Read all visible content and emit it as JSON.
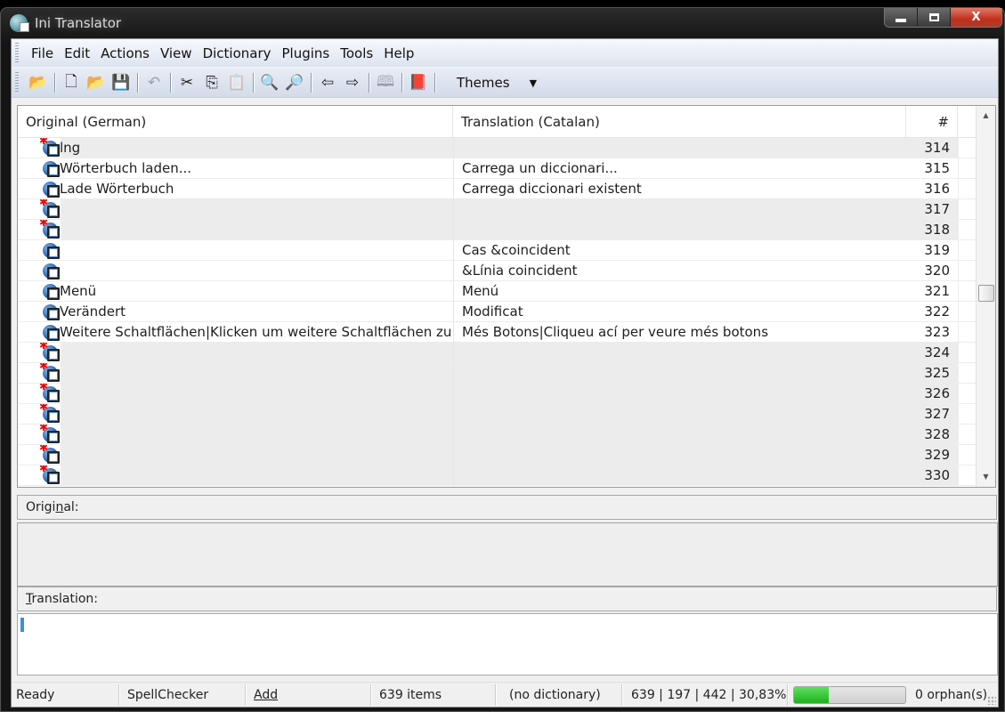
{
  "window": {
    "title": "Ini Translator",
    "controls": {
      "minimize_icon": "minimize-icon",
      "maximize_icon": "maximize-icon",
      "close_label": "X"
    }
  },
  "menubar": {
    "items": [
      "File",
      "Edit",
      "Actions",
      "View",
      "Dictionary",
      "Plugins",
      "Tools",
      "Help"
    ]
  },
  "toolbar": {
    "buttons": [
      {
        "name": "reload-files",
        "icon": "folder-refresh-icon",
        "glyph": "📂"
      },
      {
        "sep": true
      },
      {
        "name": "new-file",
        "icon": "new-document-icon",
        "glyph": "🗋"
      },
      {
        "name": "open-file",
        "icon": "open-folder-icon",
        "glyph": "📂"
      },
      {
        "name": "save",
        "icon": "floppy-disk-icon",
        "glyph": "💾"
      },
      {
        "sep": true
      },
      {
        "name": "undo",
        "icon": "undo-icon",
        "glyph": "↶",
        "disabled": true
      },
      {
        "sep": true
      },
      {
        "name": "cut",
        "icon": "scissors-icon",
        "glyph": "✂"
      },
      {
        "name": "copy",
        "icon": "copy-icon",
        "glyph": "⎘"
      },
      {
        "name": "paste",
        "icon": "paste-icon",
        "glyph": "📋",
        "disabled": true
      },
      {
        "sep": true
      },
      {
        "name": "find",
        "icon": "magnifier-icon",
        "glyph": "🔍"
      },
      {
        "name": "replace",
        "icon": "find-replace-icon",
        "glyph": "🔎"
      },
      {
        "sep": true
      },
      {
        "name": "previous",
        "icon": "arrow-left-icon",
        "glyph": "⇦"
      },
      {
        "name": "next",
        "icon": "arrow-right-icon",
        "glyph": "⇨"
      },
      {
        "sep": true
      },
      {
        "name": "copy-original",
        "icon": "book-copy-icon",
        "glyph": "🕮",
        "disabled": true
      },
      {
        "sep": true
      },
      {
        "name": "dictionary",
        "icon": "dictionary-book-icon",
        "glyph": "📕"
      },
      {
        "sep": true
      }
    ],
    "themes_label": "Themes",
    "themes_arrow": "▼"
  },
  "grid": {
    "columns": [
      "Original (German)",
      "Translation (Catalan)",
      "#"
    ],
    "rows": [
      {
        "original": "lng",
        "translation": "",
        "num": "314",
        "status": "untranslated"
      },
      {
        "original": "Wörterbuch laden...",
        "translation": "Carrega un diccionari...",
        "num": "315",
        "status": "translated"
      },
      {
        "original": "Lade Wörterbuch",
        "translation": "Carrega diccionari existent",
        "num": "316",
        "status": "translated"
      },
      {
        "original": "",
        "translation": "",
        "num": "317",
        "status": "untranslated"
      },
      {
        "original": "",
        "translation": "",
        "num": "318",
        "status": "untranslated"
      },
      {
        "original": "",
        "translation": "Cas &coincident",
        "num": "319",
        "status": "translated"
      },
      {
        "original": "",
        "translation": "&Línia coincident",
        "num": "320",
        "status": "translated"
      },
      {
        "original": "Menü",
        "translation": "Menú",
        "num": "321",
        "status": "translated"
      },
      {
        "original": "Verändert",
        "translation": "Modificat",
        "num": "322",
        "status": "translated"
      },
      {
        "original": "Weitere Schaltflächen|Klicken um weitere Schaltflächen zu ...",
        "translation": "Més Botons|Cliqueu ací per veure més botons",
        "num": "323",
        "status": "translated"
      },
      {
        "original": "",
        "translation": "",
        "num": "324",
        "status": "untranslated"
      },
      {
        "original": "",
        "translation": "",
        "num": "325",
        "status": "untranslated"
      },
      {
        "original": "",
        "translation": "",
        "num": "326",
        "status": "untranslated"
      },
      {
        "original": "",
        "translation": "",
        "num": "327",
        "status": "untranslated"
      },
      {
        "original": "",
        "translation": "",
        "num": "328",
        "status": "untranslated"
      },
      {
        "original": "",
        "translation": "",
        "num": "329",
        "status": "untranslated"
      },
      {
        "original": "",
        "translation": "",
        "num": "330",
        "status": "untranslated"
      }
    ],
    "scroll_position": 0.49
  },
  "panels": {
    "original_label": "Original:",
    "original_text": "",
    "translation_label": "Translation:",
    "translation_value": ""
  },
  "statusbar": {
    "state": "Ready",
    "spellchecker": "SpellChecker",
    "add": "Add",
    "items": "639 items",
    "dictionary": "(no dictionary)",
    "stats": "639 | 197 | 442 | 30,83%",
    "progress": 0.3083,
    "orphans": "0 orphan(s)",
    "progress_color": "#1fb01f"
  }
}
